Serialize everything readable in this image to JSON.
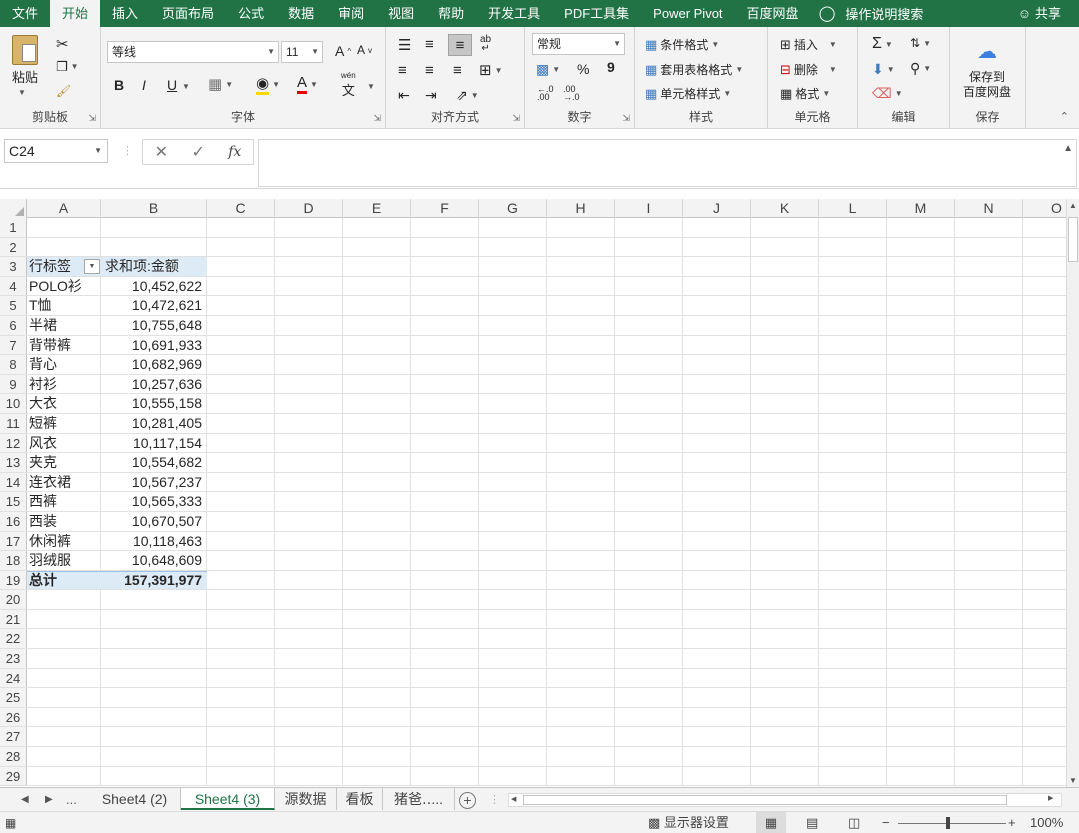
{
  "menubar": {
    "tabs": [
      "文件",
      "开始",
      "插入",
      "页面布局",
      "公式",
      "数据",
      "审阅",
      "视图",
      "帮助",
      "开发工具",
      "PDF工具集",
      "Power Pivot",
      "百度网盘"
    ],
    "active_tab": "开始",
    "tell_me": "操作说明搜索",
    "share": "共享"
  },
  "ribbon": {
    "clipboard": {
      "label": "剪贴板",
      "paste": "粘贴"
    },
    "font": {
      "label": "字体",
      "font_name": "等线",
      "font_size": "11",
      "bold": "B",
      "italic": "I",
      "underline": "U",
      "wen": "wén",
      "wen_char": "文"
    },
    "alignment": {
      "label": "对齐方式",
      "ab": "ab"
    },
    "number": {
      "label": "数字",
      "format": "常规",
      "percent": "%",
      "comma": "9"
    },
    "styles": {
      "label": "样式",
      "conditional": "条件格式",
      "table": "套用表格格式",
      "cell_styles": "单元格样式"
    },
    "cells": {
      "label": "单元格",
      "insert": "插入",
      "delete": "删除",
      "format": "格式"
    },
    "editing": {
      "label": "编辑"
    },
    "save": {
      "label": "保存",
      "button": "保存到\n百度网盘"
    }
  },
  "formula_bar": {
    "name_box": "C24",
    "formula": ""
  },
  "grid": {
    "columns": [
      "A",
      "B",
      "C",
      "D",
      "E",
      "F",
      "G",
      "H",
      "I",
      "J",
      "K",
      "L",
      "M",
      "N",
      "O"
    ],
    "row_count": 29,
    "pivot": {
      "header_row": 3,
      "row_label": "行标签",
      "value_label": "求和项:金额",
      "items": [
        {
          "label": "POLO衫",
          "value": "10,452,622"
        },
        {
          "label": "T恤",
          "value": "10,472,621"
        },
        {
          "label": "半裙",
          "value": "10,755,648"
        },
        {
          "label": "背带裤",
          "value": "10,691,933"
        },
        {
          "label": "背心",
          "value": "10,682,969"
        },
        {
          "label": "衬衫",
          "value": "10,257,636"
        },
        {
          "label": "大衣",
          "value": "10,555,158"
        },
        {
          "label": "短裤",
          "value": "10,281,405"
        },
        {
          "label": "风衣",
          "value": "10,117,154"
        },
        {
          "label": "夹克",
          "value": "10,554,682"
        },
        {
          "label": "连衣裙",
          "value": "10,567,237"
        },
        {
          "label": "西裤",
          "value": "10,565,333"
        },
        {
          "label": "西装",
          "value": "10,670,507"
        },
        {
          "label": "休闲裤",
          "value": "10,118,463"
        },
        {
          "label": "羽绒服",
          "value": "10,648,609"
        }
      ],
      "total_label": "总计",
      "total_value": "157,391,977"
    }
  },
  "sheet_tabs": {
    "ellipsis": "...",
    "tabs": [
      "Sheet4 (2)",
      "Sheet4 (3)",
      "源数据",
      "看板",
      "猪爸‥..."
    ],
    "active": "Sheet4 (3)"
  },
  "statusbar": {
    "display_settings": "显示器设置",
    "zoom": "100%"
  },
  "colors": {
    "accent": "#217346",
    "pivot_header": "#ddebf7"
  }
}
